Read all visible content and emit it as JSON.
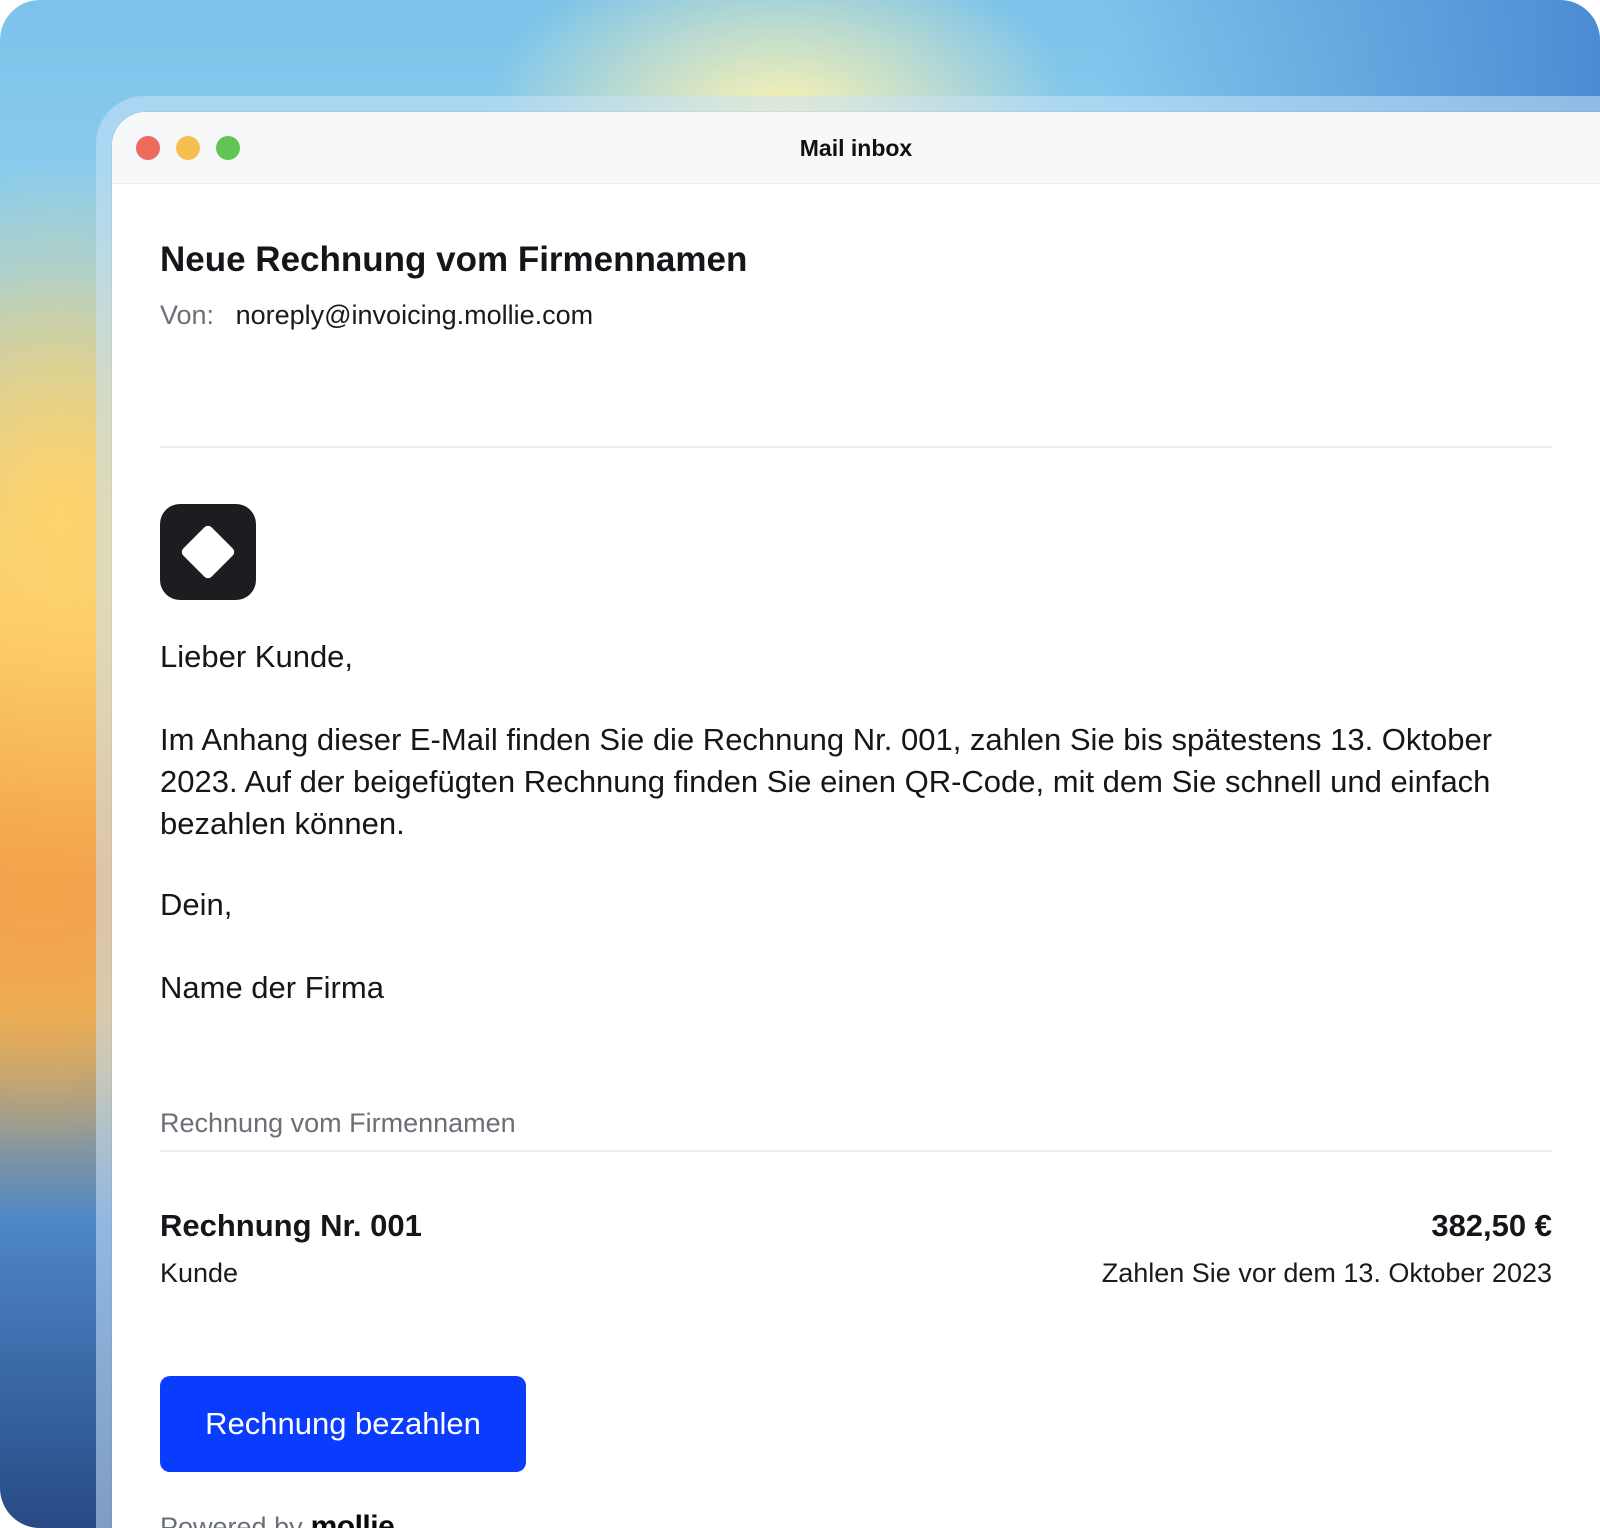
{
  "window": {
    "title": "Mail inbox"
  },
  "email": {
    "subject": "Neue Rechnung vom Firmennamen",
    "from_label": "Von:",
    "from_address": "noreply@invoicing.mollie.com",
    "greeting": "Lieber Kunde,",
    "paragraph": "Im Anhang dieser E-Mail finden Sie die Rechnung Nr. 001, zahlen Sie bis spätestens 13. Oktober 2023. Auf der beigefügten Rechnung finden Sie einen QR-Code, mit dem Sie schnell und einfach bezahlen können.",
    "closing": "Dein,",
    "signature": "Name der Firma"
  },
  "invoice": {
    "section_label": "Rechnung vom Firmennamen",
    "number": "Rechnung Nr. 001",
    "customer": "Kunde",
    "amount": "382,50 €",
    "due_text": "Zahlen Sie vor dem 13. Oktober 2023",
    "pay_button_label": "Rechnung bezahlen"
  },
  "footer": {
    "powered_by": "Powered by",
    "brand": "mollie"
  },
  "colors": {
    "accent": "#0a3cff",
    "logo_bg": "#1c1d21",
    "traffic_red": "#ec6a5e",
    "traffic_yellow": "#f4bf4f",
    "traffic_green": "#61c554"
  },
  "icons": {
    "company_logo": "diamond-logo-icon"
  }
}
